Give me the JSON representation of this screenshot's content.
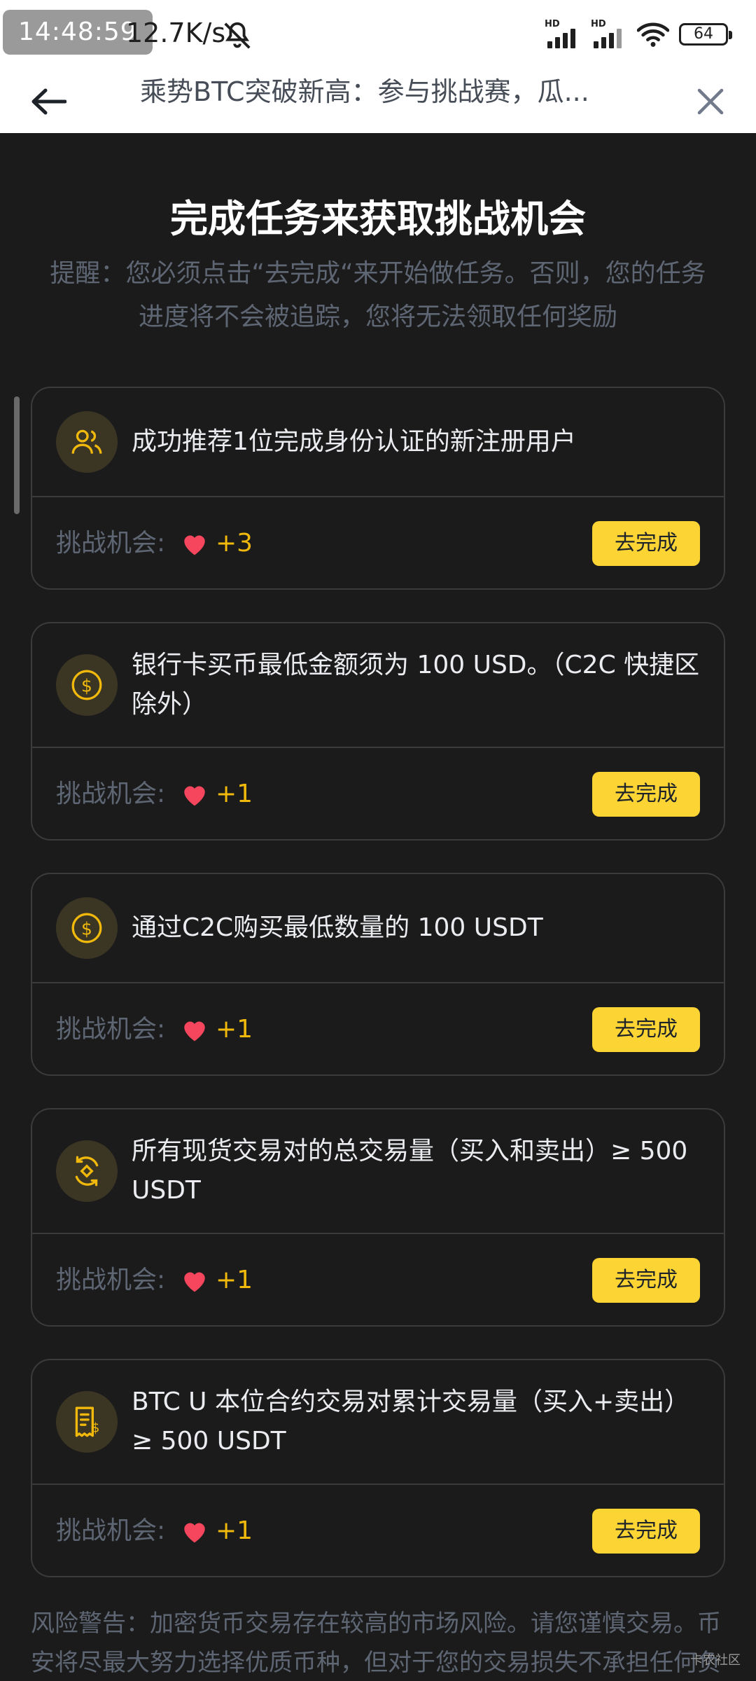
{
  "status_bar": {
    "time": "14:48:59",
    "net_speed": "12.7K/s",
    "signal_1_label": "HD",
    "signal_2_label": "HD",
    "battery": "64",
    "icons": [
      "mute-icon",
      "signal-icon",
      "wifi-icon",
      "battery-icon"
    ]
  },
  "header": {
    "title": "乘势BTC突破新高：参与挑战赛，瓜...",
    "back_icon": "arrow-left-icon",
    "close_icon": "close-icon"
  },
  "page": {
    "title": "完成任务来获取挑战机会",
    "reminder": "提醒：您必须点击“去完成“来开始做任务。否则，您的任务进度将不会被追踪，您将无法领取任何奖励"
  },
  "tasks": [
    {
      "icon": "users-icon",
      "text": "成功推荐1位完成身份认证的新注册用户",
      "chance_label": "挑战机会:",
      "chance_value": "+3",
      "button": "去完成"
    },
    {
      "icon": "dollar-coin-icon",
      "text": "银行卡买币最低金额须为 100 USD。（C2C 快捷区除外）",
      "chance_label": "挑战机会:",
      "chance_value": "+1",
      "button": "去完成"
    },
    {
      "icon": "dollar-coin-icon",
      "text": "通过C2C购买最低数量的 100 USDT",
      "chance_label": "挑战机会:",
      "chance_value": "+1",
      "button": "去完成"
    },
    {
      "icon": "spot-trade-icon",
      "text": "所有现货交易对的总交易量（买入和卖出）≥ 500 USDT",
      "chance_label": "挑战机会:",
      "chance_value": "+1",
      "button": "去完成"
    },
    {
      "icon": "futures-receipt-icon",
      "text": "BTC U 本位合约交易对累计交易量（买入+卖出）≥ 500 USDT",
      "chance_label": "挑战机会:",
      "chance_value": "+1",
      "button": "去完成"
    }
  ],
  "risk_warning": "风险警告：加密货币交易存在较高的市场风险。请您谨慎交易。币安将尽最大努力选择优质币种，但对于您的交易损失不承担任何负责。币安保留随时会报酬情用任何理由修改、变更或取消此公告的权利",
  "watermark": "卡农社区",
  "colors": {
    "background": "#1b1b1c",
    "accent_yellow": "#fcd535",
    "chance_yellow": "#f0b90b",
    "muted_text": "#5e6673",
    "heart_red": "#f6465d"
  }
}
